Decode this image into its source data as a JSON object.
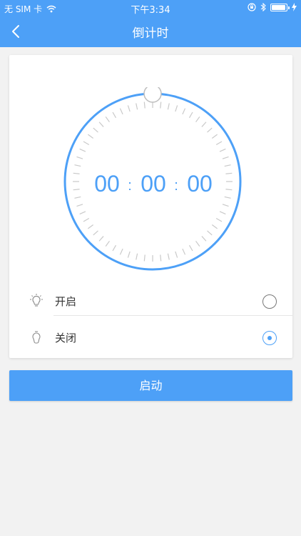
{
  "status_bar": {
    "carrier": "无 SIM 卡",
    "time": "下午3:34",
    "wifi_icon": "wifi-icon",
    "lock_icon": "rotation-lock-icon",
    "bluetooth_icon": "bluetooth-icon",
    "battery_icon": "battery-icon",
    "charging_icon": "charging-bolt-icon"
  },
  "nav": {
    "title": "倒计时",
    "back_icon": "chevron-left-icon"
  },
  "timer": {
    "hours": "00",
    "minutes": "00",
    "seconds": "00",
    "separator": ":",
    "progress": 0,
    "accent_color": "#4da0f7"
  },
  "options": [
    {
      "label": "开启",
      "icon": "light-bulb-icon",
      "selected": false
    },
    {
      "label": "关闭",
      "icon": "light-off-icon",
      "selected": true
    }
  ],
  "start_button": {
    "label": "启动"
  },
  "colors": {
    "primary": "#4da0f7",
    "background": "#f2f2f2",
    "tick": "#c9c9c9"
  }
}
